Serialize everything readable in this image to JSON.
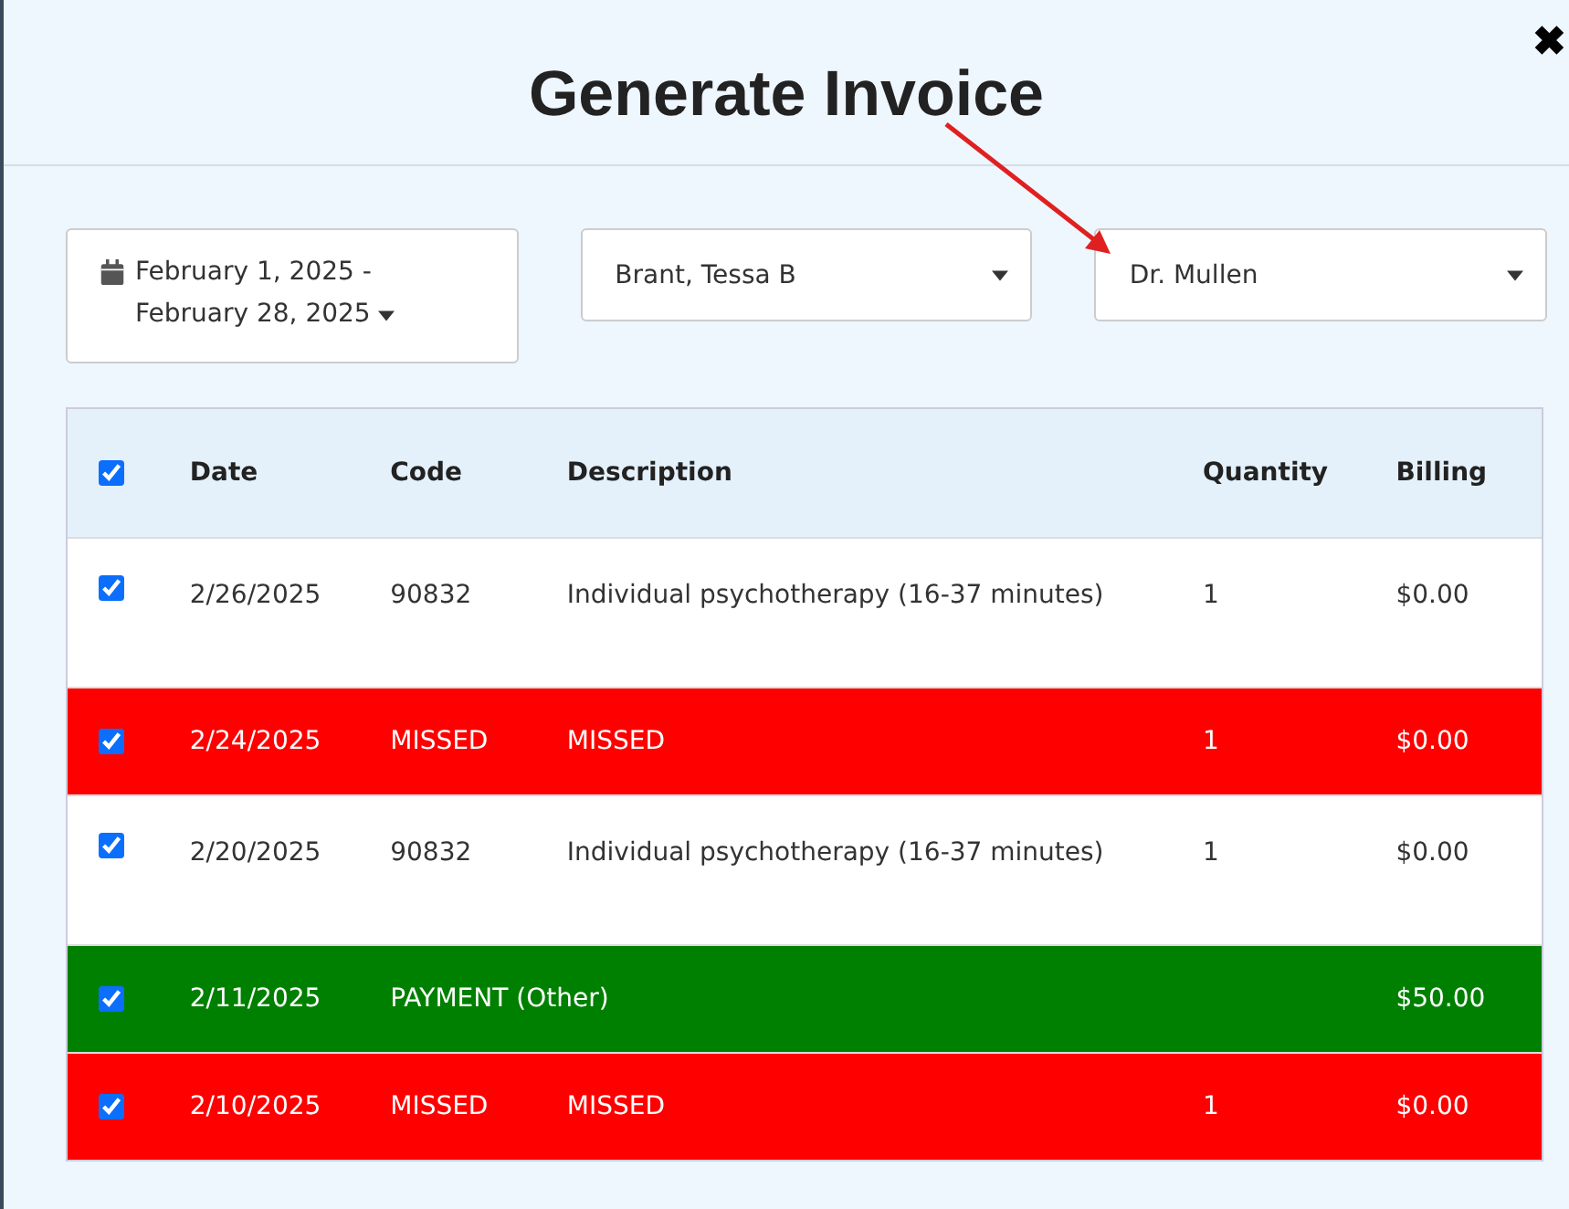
{
  "modal": {
    "title": "Generate Invoice",
    "close": "✖"
  },
  "filters": {
    "date_range": "February 1, 2025 - February 28, 2025",
    "client": "Brant, Tessa B",
    "provider": "Dr. Mullen"
  },
  "table": {
    "select_all_checked": true,
    "columns": [
      "Date",
      "Code",
      "Description",
      "Quantity",
      "Billing"
    ],
    "rows": [
      {
        "kind": "service",
        "checked": true,
        "date": "2/26/2025",
        "code": "90832",
        "description": "Individual psychotherapy (16-37 minutes)",
        "quantity": "1",
        "billing": "$0.00"
      },
      {
        "kind": "missed",
        "checked": true,
        "date": "2/24/2025",
        "code": "MISSED",
        "description": "MISSED",
        "quantity": "1",
        "billing": "$0.00"
      },
      {
        "kind": "service",
        "checked": true,
        "date": "2/20/2025",
        "code": "90832",
        "description": "Individual psychotherapy (16-37 minutes)",
        "quantity": "1",
        "billing": "$0.00"
      },
      {
        "kind": "payment",
        "checked": true,
        "date": "2/11/2025",
        "code": "PAYMENT (Other)",
        "billing": "$50.00"
      },
      {
        "kind": "missed",
        "checked": true,
        "date": "2/10/2025",
        "code": "MISSED",
        "description": "MISSED",
        "quantity": "1",
        "billing": "$0.00"
      }
    ]
  }
}
